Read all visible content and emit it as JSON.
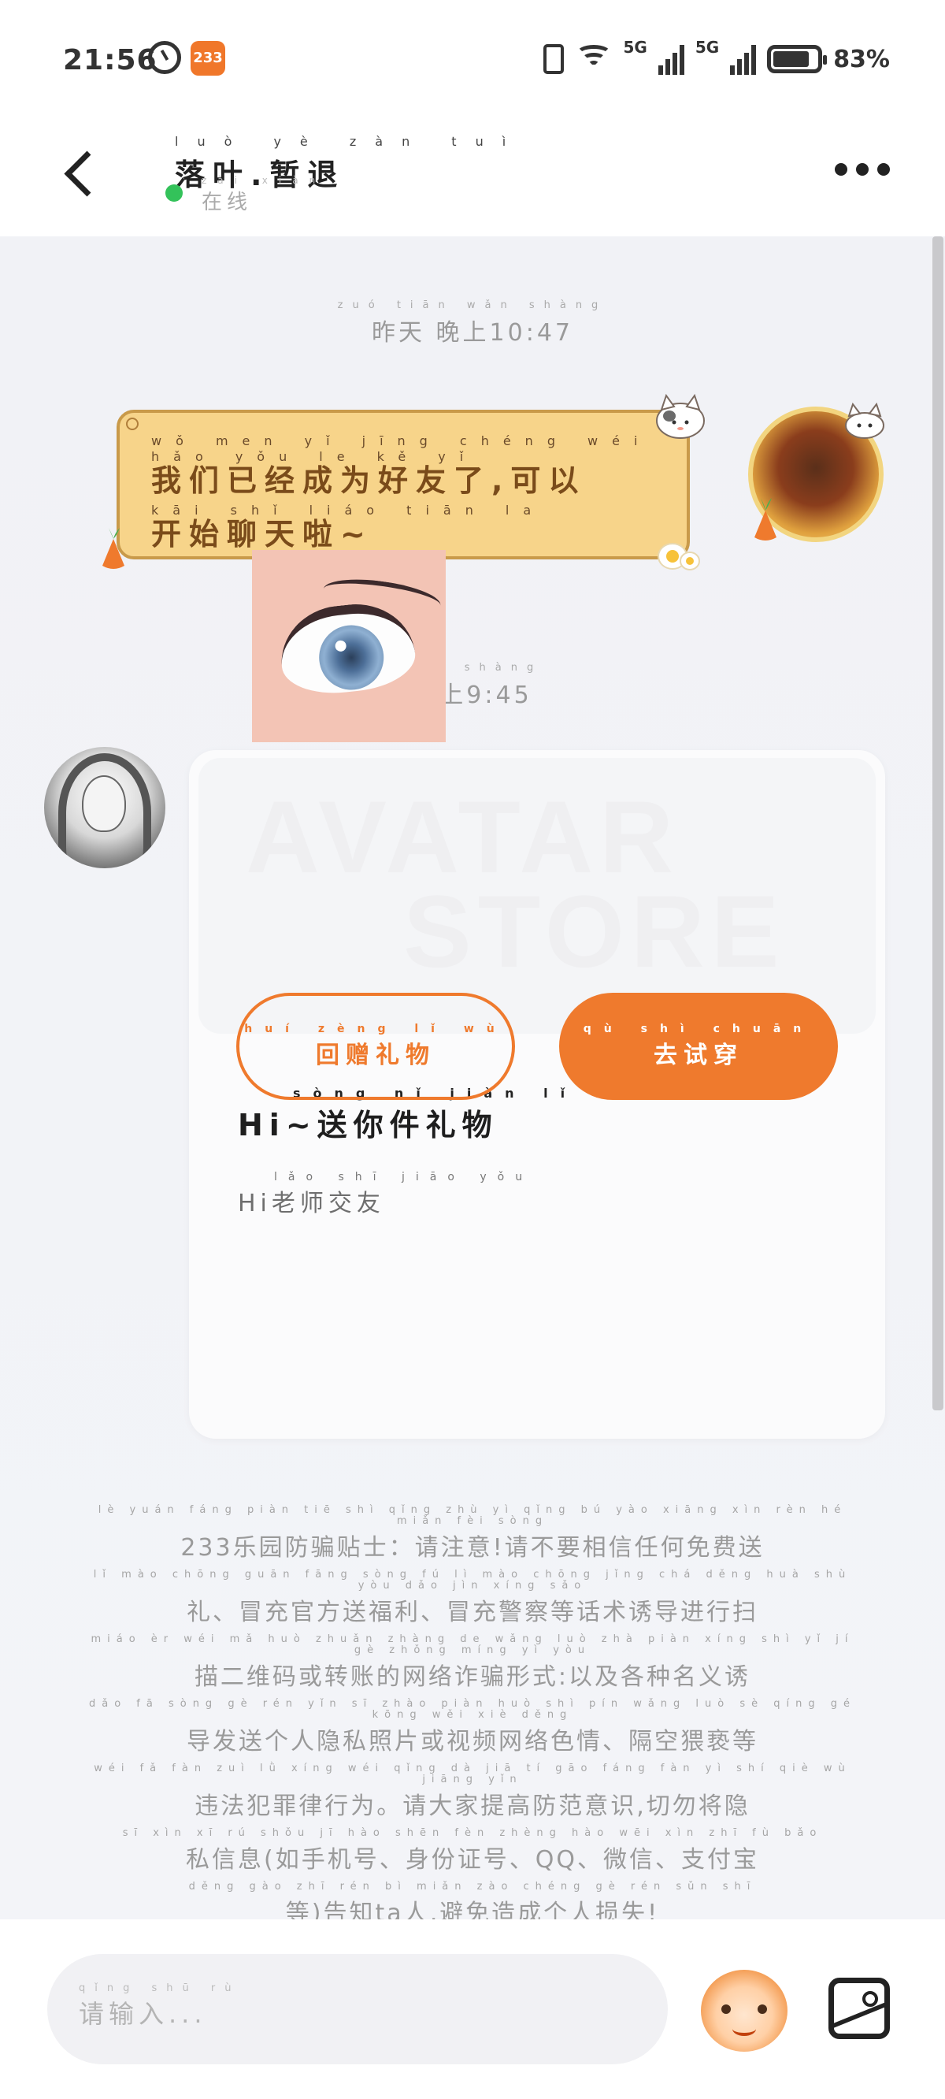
{
  "status_bar": {
    "time": "21:56",
    "app_badge": "233",
    "net1": "5G",
    "net2": "5G",
    "battery_level": 0.83,
    "battery_pct": "83%"
  },
  "header": {
    "name_pinyin": "luò yè zàn tuì",
    "name": "落叶.暂退",
    "status_pinyin": "zài xiàn",
    "status": "在线"
  },
  "messages": {
    "ts1_pinyin": "zuó tiān wǎn shàng",
    "ts1": "昨天 晚上10:47",
    "system_line1_pinyin": "wǒ men yǐ jīng chéng wéi hǎo yǒu le kě yǐ",
    "system_line1": "我们已经成为好友了,可以",
    "system_line2_pinyin": "kāi shǐ liáo tiān la",
    "system_line2": "开始聊天啦~",
    "ts2_pinyin": "wǎn shàng",
    "ts2": "晚上9:45"
  },
  "gift_card": {
    "watermark_1": "AVATAR",
    "watermark_2": "STORE",
    "title_pinyin": "sòng nǐ jiàn lǐ wù",
    "title": "Hi~送你件礼物",
    "subtitle_pinyin": "lǎo shī jiāo yǒu",
    "subtitle": "Hi老师交友",
    "btn_return_pinyin": "huí zèng lǐ wù",
    "btn_return": "回赠礼物",
    "btn_try_pinyin": "qù shì chuān",
    "btn_try": "去试穿"
  },
  "tips": {
    "lines": [
      {
        "py": "lè yuán fáng piàn tiē shì qǐng zhù yì qǐng bú yào xiāng xìn rèn hé miǎn fèi sòng",
        "tx": "233乐园防骗贴士：请注意!请不要相信任何免费送"
      },
      {
        "py": "lǐ mào chōng guān fāng sòng fú lì mào chōng jǐng chá děng huà shù yòu dǎo jìn xíng sǎo",
        "tx": "礼、冒充官方送福利、冒充警察等话术诱导进行扫"
      },
      {
        "py": "miáo èr wéi mǎ huò zhuǎn zhàng de wǎng luò zhà piàn xíng shì yǐ jí gè zhǒng míng yì yòu",
        "tx": "描二维码或转账的网络诈骗形式:以及各种名义诱"
      },
      {
        "py": "dǎo fā sòng gè rén yǐn sī zhào piàn huò shì pín wǎng luò sè qíng gé kōng wěi xiè děng",
        "tx": "导发送个人隐私照片或视频网络色情、隔空猥亵等"
      },
      {
        "py": "wéi fǎ fàn zuì lǜ xíng wéi qǐng dà jiā tí gāo fáng fàn yì shí qiè wù jiāng yǐn",
        "tx": "违法犯罪律行为。请大家提高防范意识,切勿将隐"
      },
      {
        "py": "sī xìn xī rú shǒu jī hào shēn fèn zhèng hào wēi xìn zhī fù bǎo",
        "tx": "私信息(如手机号、身份证号、QQ、微信、支付宝"
      },
      {
        "py": "děng gào zhī rén bì miǎn zào chéng gè rén sǔn shī",
        "tx": "等)告知ta人,避免造成个人损失!"
      }
    ]
  },
  "input_bar": {
    "placeholder_pinyin": "qǐng shū rù",
    "placeholder": "请输入..."
  },
  "icons": {
    "back": "back-arrow-icon",
    "more": "more-dots-icon",
    "emoji": "emoji-mascot-icon",
    "image": "image-icon"
  },
  "colors": {
    "accent": "#ef7a2d",
    "online": "#33c25a",
    "system_card_bg": "#f7d48a"
  }
}
